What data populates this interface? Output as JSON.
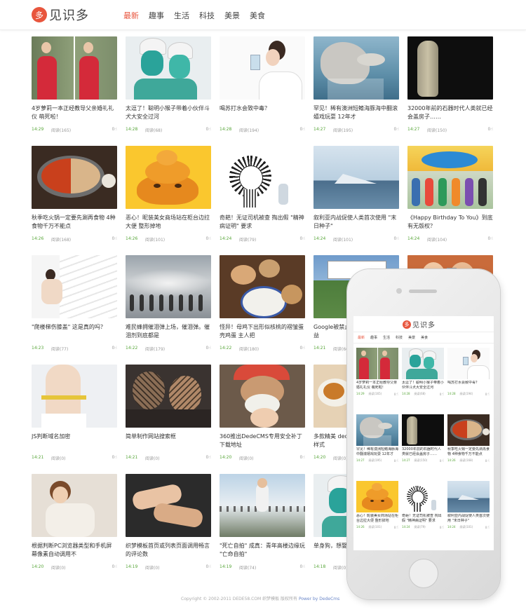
{
  "header": {
    "logo_char": "多",
    "logo_text": "见识多",
    "nav": [
      "最新",
      "趣事",
      "生活",
      "科技",
      "美景",
      "美食"
    ]
  },
  "cards": [
    {
      "title": "4岁萝莉一本正经教导父亲婚礼礼仪 萌死啦！",
      "time": "14:29",
      "views": "阅读(165)",
      "likes": "0",
      "img": "girl-red-dress"
    },
    {
      "title": "太逗了！聪明小猴子带着小伙伴斗犬大安全过河",
      "time": "14:28",
      "views": "阅读(68)",
      "likes": "0",
      "img": "towel-face-paint"
    },
    {
      "title": "喝苏打水会致中毒？",
      "time": "14:28",
      "views": "阅读(194)",
      "likes": "0",
      "img": "woman-drinking-water"
    },
    {
      "title": "罕见！稀有澳洲短鳍海豚海中翻滚嬉戏玩耍 12年才",
      "time": "14:27",
      "views": "阅读(195)",
      "likes": "0",
      "img": "dolphin"
    },
    {
      "title": "32000年前的石器时代人类就已经会盖房子……",
      "time": "14:27",
      "views": "阅读(150)",
      "likes": "0",
      "img": "stone-artifact"
    },
    {
      "title": "秋季吃火锅一定要先涮再食物 4种食物千万不能点",
      "time": "14:26",
      "views": "阅读(168)",
      "likes": "0",
      "img": "hotpot"
    },
    {
      "title": "恶心！昵装美女商场站在柜台边拉大便 整形掉地",
      "time": "14:26",
      "views": "阅读(101)",
      "likes": "0",
      "img": "poop-emoji"
    },
    {
      "title": "奇葩！无证司机被查 掏出假 \"精神病证明\" 要求",
      "time": "14:24",
      "views": "阅读(79)",
      "likes": "0",
      "img": "cartoon-mad"
    },
    {
      "title": "叙利亚内战促使人类首次使用 \"末日种子\"",
      "time": "14:24",
      "views": "阅读(101)",
      "likes": "0",
      "img": "ice-landscape"
    },
    {
      "title": "《Happy Birthday To You》到底有无版权？",
      "time": "14:24",
      "views": "阅读(104)",
      "likes": "0",
      "img": "kids-birthday"
    },
    {
      "title": "\"爬楼梯伤膝盖\" 这是真的吗？",
      "time": "14:23",
      "views": "阅读(77)",
      "likes": "0",
      "img": "woman-stairs"
    },
    {
      "title": "难民蜂拥催泪弹上场，催泪弹。催泪剂到底都是",
      "time": "14:22",
      "views": "阅读(179)",
      "likes": "0",
      "img": "tear-gas"
    },
    {
      "title": "怪异！母鸡下出形似核桃的褶皱蛋 壳鸡蛋 主人把",
      "time": "14:22",
      "views": "阅读(180)",
      "likes": "0",
      "img": "eggs"
    },
    {
      "title": "Google被禁止…事件 多方质疑 多益",
      "time": "14:21",
      "views": "阅读(66)",
      "likes": "0",
      "img": "google-sign"
    },
    {
      "title": "",
      "time": "",
      "views": "",
      "likes": "",
      "img": "woman-phone"
    },
    {
      "title": "JS判断域名加密",
      "time": "14:21",
      "views": "阅读(0)",
      "likes": "0",
      "img": "waist-measure"
    },
    {
      "title": "简单制作网站搜索框",
      "time": "14:21",
      "views": "阅读(0)",
      "likes": "0",
      "img": "tattoo-couple"
    },
    {
      "title": "360推出DedeCMS专用安全补丁下载地址",
      "time": "14:20",
      "views": "阅读(0)",
      "likes": "0",
      "img": "old-man-baby"
    },
    {
      "title": "多款精美 dedecms模板免费下载样式",
      "time": "14:20",
      "views": "阅读(0)",
      "likes": "0",
      "img": "breakfast"
    },
    {
      "title": "",
      "time": "",
      "views": "",
      "likes": "",
      "img": "blank"
    },
    {
      "title": "根据判断PC浏览器类型和手机屏幕像素自动调用不",
      "time": "14:20",
      "views": "阅读(0)",
      "likes": "0",
      "img": "woman-sofa"
    },
    {
      "title": "织梦模板首页或列表页面调用畅言的评论数",
      "time": "14:19",
      "views": "阅读(0)",
      "likes": "0",
      "img": "hands"
    },
    {
      "title": "\"死亡自拍\" 成真：青年高楼边缘玩 \"亡命自拍\"",
      "time": "14:19",
      "views": "阅读(74)",
      "likes": "0",
      "img": "bridge-selfie"
    },
    {
      "title": "单身狗，想娶媳妇吗？",
      "time": "14:18",
      "views": "阅读(0)",
      "likes": "0",
      "img": "towel-face-paint"
    },
    {
      "title": "",
      "time": "",
      "views": "",
      "likes": "",
      "img": "blank"
    }
  ],
  "footer": {
    "copyright": "Copyright © 2002-2011 DEDE58.COM 织梦模板 版权所有",
    "powered": "Power by DedeCms"
  },
  "mobile": {
    "logo_char": "多",
    "logo_text": "见识多",
    "nav": [
      "最新",
      "趣事",
      "生活",
      "科技",
      "美景",
      "美食"
    ],
    "cards": [
      {
        "title": "4岁萝莉一本正经教导父亲婚礼礼仪 萌死啦！",
        "time": "14:29",
        "views": "阅读(165)",
        "likes": "0",
        "img": "girl-red-dress"
      },
      {
        "title": "太逗了！聪明小猴子带着小伙伴斗犬大安全过河",
        "time": "14:28",
        "views": "阅读(68)",
        "likes": "0",
        "img": "towel-face-paint"
      },
      {
        "title": "喝苏打水会致中毒？",
        "time": "14:28",
        "views": "阅读(194)",
        "likes": "0",
        "img": "woman-drinking-water"
      },
      {
        "title": "罕见！稀有澳洲短鳍海豚海中翻滚嬉戏玩耍 12年才",
        "time": "14:27",
        "views": "阅读(195)",
        "likes": "0",
        "img": "dolphin"
      },
      {
        "title": "32000年前的石器时代人类就已经会盖房子……",
        "time": "14:27",
        "views": "阅读(150)",
        "likes": "0",
        "img": "stone-artifact"
      },
      {
        "title": "秋季吃火锅一定要先涮再食物 4种食物千万不能点",
        "time": "14:26",
        "views": "阅读(168)",
        "likes": "0",
        "img": "hotpot"
      },
      {
        "title": "恶心！昵装美女商场站在柜台边拉大便 整形掉地",
        "time": "14:26",
        "views": "阅读(101)",
        "likes": "0",
        "img": "poop-emoji"
      },
      {
        "title": "奇葩！无证司机被查 掏出假 \"精神病证明\" 要求",
        "time": "14:24",
        "views": "阅读(79)",
        "likes": "0",
        "img": "cartoon-mad"
      },
      {
        "title": "叙利亚内战促使人类首次使用 \"末日种子\"",
        "time": "14:24",
        "views": "阅读(101)",
        "likes": "0",
        "img": "ice-landscape"
      }
    ]
  }
}
